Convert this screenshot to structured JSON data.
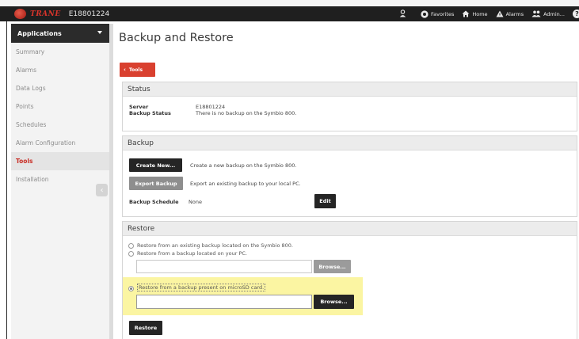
{
  "header": {
    "brand": "TRANE",
    "device_id": "E18801224",
    "nav": [
      "Favorites",
      "Home",
      "Alarms",
      "Admin..."
    ],
    "accent_color": "#d9342b"
  },
  "sidebar": {
    "title": "Applications",
    "items": [
      {
        "label": "Summary",
        "active": false
      },
      {
        "label": "Alarms",
        "active": false
      },
      {
        "label": "Data Logs",
        "active": false
      },
      {
        "label": "Points",
        "active": false
      },
      {
        "label": "Schedules",
        "active": false
      },
      {
        "label": "Alarm Configuration",
        "active": false
      },
      {
        "label": "Tools",
        "active": true
      },
      {
        "label": "Installation",
        "active": false
      }
    ]
  },
  "page": {
    "title": "Backup and Restore",
    "back_button": "Tools"
  },
  "status": {
    "title": "Status",
    "server_label": "Server",
    "server_value": "E18801224",
    "backup_status_label": "Backup Status",
    "backup_status_value": "There is no backup on the Symbio 800."
  },
  "backup": {
    "title": "Backup",
    "create_button": "Create New...",
    "create_desc": "Create a new backup on the Symbio 800.",
    "export_button": "Export Backup",
    "export_desc": "Export an existing backup to your local PC.",
    "schedule_label": "Backup Schedule",
    "schedule_value": "None",
    "edit_button": "Edit"
  },
  "restore": {
    "title": "Restore",
    "options": [
      {
        "label": "Restore from an existing backup located on the Symbio 800.",
        "selected": false
      },
      {
        "label": "Restore from a backup located on your PC.",
        "selected": false
      },
      {
        "label": "Restore from a backup present on microSD card.",
        "selected": true
      }
    ],
    "pc_file_value": "",
    "sd_file_value": "",
    "browse_button": "Browse...",
    "restore_button": "Restore"
  }
}
